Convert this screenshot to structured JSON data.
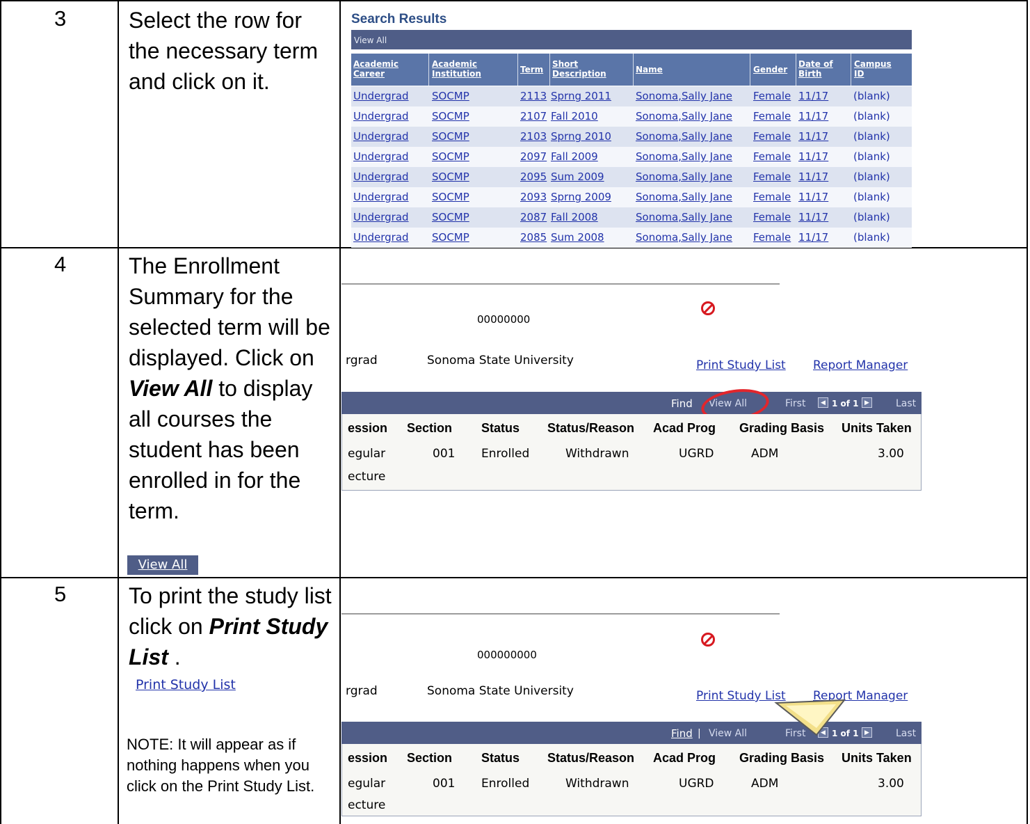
{
  "steps": [
    {
      "num": "3",
      "text": "Select the row for the necessary term and click on it."
    },
    {
      "num": "4",
      "text_before": "The Enrollment Summary for the selected term will be displayed. Click on ",
      "emphasis": "View All",
      "text_after": " to display all courses the student has been enrolled in for the term.",
      "button_label": "View All"
    },
    {
      "num": "5",
      "text_before": "To print the study list click on ",
      "emphasis": "Print Study List",
      "text_after": " .",
      "link_label": "Print Study List",
      "note": "NOTE: It will appear as if nothing happens when you click on the Print Study List."
    }
  ],
  "search_results": {
    "title": "Search Results",
    "bar_label": "View All",
    "headers": [
      "Academic Career",
      "Academic Institution",
      "Term",
      "Short Description",
      "Name",
      "Gender",
      "Date of Birth",
      "Campus ID"
    ],
    "rows": [
      [
        "Undergrad",
        "SOCMP",
        "2113",
        "Sprng 2011",
        "Sonoma,Sally Jane",
        "Female",
        "11/17",
        "(blank)"
      ],
      [
        "Undergrad",
        "SOCMP",
        "2107",
        "Fall 2010",
        "Sonoma,Sally Jane",
        "Female",
        "11/17",
        "(blank)"
      ],
      [
        "Undergrad",
        "SOCMP",
        "2103",
        "Sprng 2010",
        "Sonoma,Sally Jane",
        "Female",
        "11/17",
        "(blank)"
      ],
      [
        "Undergrad",
        "SOCMP",
        "2097",
        "Fall 2009",
        "Sonoma,Sally Jane",
        "Female",
        "11/17",
        "(blank)"
      ],
      [
        "Undergrad",
        "SOCMP",
        "2095",
        "Sum 2009",
        "Sonoma,Sally Jane",
        "Female",
        "11/17",
        "(blank)"
      ],
      [
        "Undergrad",
        "SOCMP",
        "2093",
        "Sprng 2009",
        "Sonoma,Sally Jane",
        "Female",
        "11/17",
        "(blank)"
      ],
      [
        "Undergrad",
        "SOCMP",
        "2087",
        "Fall 2008",
        "Sonoma,Sally Jane",
        "Female",
        "11/17",
        "(blank)"
      ],
      [
        "Undergrad",
        "SOCMP",
        "2085",
        "Sum 2008",
        "Sonoma,Sally Jane",
        "Female",
        "11/17",
        "(blank)"
      ]
    ]
  },
  "panel4": {
    "id": "00000000",
    "career": "rgrad",
    "institution": "Sonoma State University",
    "print_link": "Print Study List",
    "report_link": "Report Manager",
    "nav": {
      "find": "Find",
      "view_all": "View All",
      "first": "First",
      "page": "1 of 1",
      "last": "Last"
    },
    "columns": [
      "ession",
      "Section",
      "Status",
      "Status/Reason",
      "Acad Prog",
      "Grading Basis",
      "Units Taken"
    ],
    "row": [
      "egular",
      "001",
      "Enrolled",
      "Withdrawn",
      "UGRD",
      "ADM",
      "3.00"
    ],
    "row2": "ecture"
  },
  "panel5": {
    "id": "000000000",
    "career": "rgrad",
    "institution": "Sonoma State University",
    "print_link": "Print Study List",
    "report_link": "Report Manager",
    "nav": {
      "find": "Find",
      "sep": "|",
      "view_all": "View All",
      "first": "First",
      "page": "1 of 1",
      "last": "Last"
    },
    "columns": [
      "ession",
      "Section",
      "Status",
      "Status/Reason",
      "Acad Prog",
      "Grading Basis",
      "Units Taken"
    ],
    "row": [
      "egular",
      "001",
      "Enrolled",
      "Withdrawn",
      "UGRD",
      "ADM",
      "3.00"
    ],
    "row2": "ecture"
  },
  "colors": {
    "accent_bar": "#4f5d87",
    "header": "#5a75a8",
    "link": "#2233aa",
    "highlight": "#e2262c"
  }
}
